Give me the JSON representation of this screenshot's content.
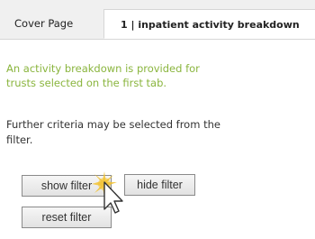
{
  "tabs": [
    {
      "label": "Cover Page"
    },
    {
      "label": "1 | inpatient activity breakdown"
    }
  ],
  "content": {
    "intro_line1": "An activity breakdown is provided for",
    "intro_line2": "trusts selected on the first tab.",
    "criteria_line1": "Further criteria may be selected from the",
    "criteria_line2": "filter."
  },
  "buttons": {
    "show_filter": "show filter",
    "hide_filter": "hide filter",
    "reset_filter": "reset filter"
  },
  "colors": {
    "accent_green": "#8ab53e",
    "click_highlight": "#f2c230"
  },
  "icons": {
    "cursor": "mouse-pointer-click-icon"
  }
}
